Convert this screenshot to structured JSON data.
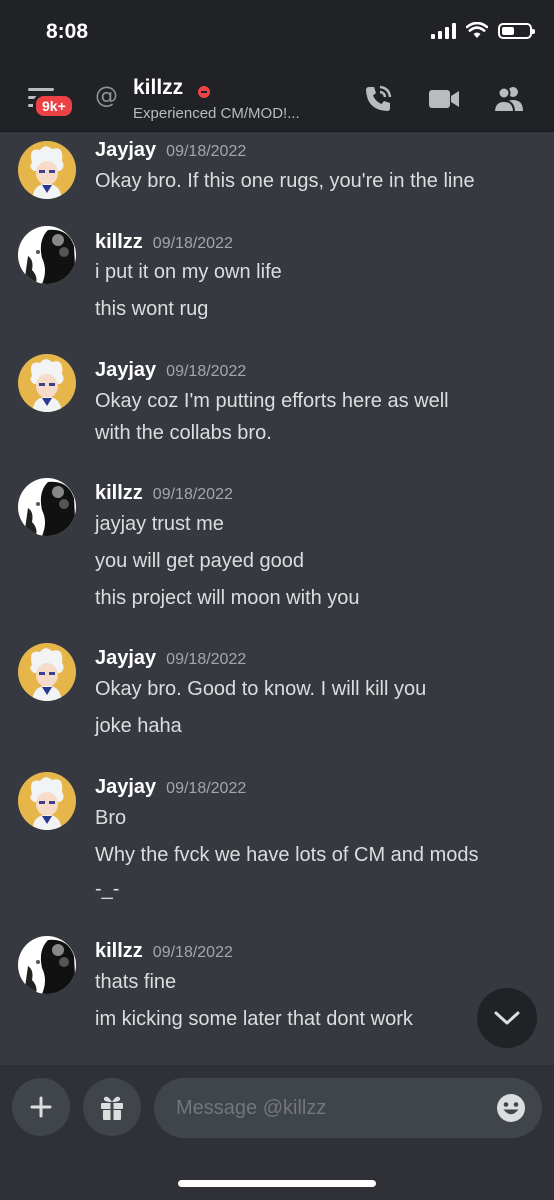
{
  "status_bar": {
    "time": "8:08"
  },
  "header": {
    "badge": "9k+",
    "channel_name": "killzz",
    "channel_status": "Experienced CM/MOD!..."
  },
  "messages": [
    {
      "author": "Jayjay",
      "timestamp": "09/18/2022",
      "avatar": "jayjay-avatar",
      "lines": [
        "Okay bro. If this one rugs, you're in the line"
      ]
    },
    {
      "author": "killzz",
      "timestamp": "09/18/2022",
      "avatar": "killzz-avatar",
      "lines": [
        "i put it on my own life",
        "this wont rug"
      ]
    },
    {
      "author": "Jayjay",
      "timestamp": "09/18/2022",
      "avatar": "jayjay-avatar",
      "lines": [
        "Okay coz I'm putting efforts here as well",
        "with the collabs bro."
      ]
    },
    {
      "author": "killzz",
      "timestamp": "09/18/2022",
      "avatar": "killzz-avatar",
      "lines": [
        "jayjay trust me",
        "you will get payed good",
        "this project will moon with you"
      ]
    },
    {
      "author": "Jayjay",
      "timestamp": "09/18/2022",
      "avatar": "jayjay-avatar",
      "lines": [
        "Okay bro. Good to know. I will kill you",
        "joke haha"
      ]
    },
    {
      "author": "Jayjay",
      "timestamp": "09/18/2022",
      "avatar": "jayjay-avatar",
      "lines": [
        "Bro",
        "Why the fvck we have lots of CM and mods",
        "-_-"
      ]
    },
    {
      "author": "killzz",
      "timestamp": "09/18/2022",
      "avatar": "killzz-avatar",
      "lines": [
        "thats fine",
        "im kicking some later that dont work"
      ]
    }
  ],
  "composer": {
    "placeholder": "Message @killzz"
  },
  "colors": {
    "background": "#36393f",
    "header": "#202225",
    "dnd": "#ed4245",
    "badge": "#ed4245"
  }
}
